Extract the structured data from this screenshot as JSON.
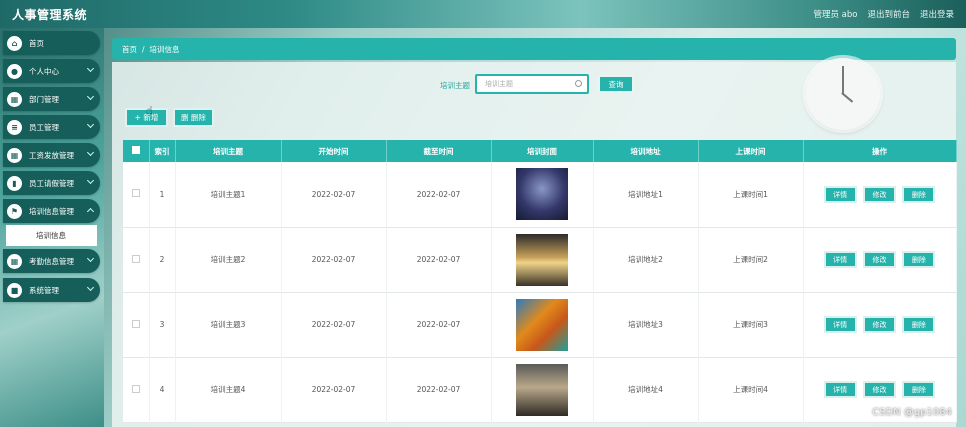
{
  "header": {
    "app_title": "人事管理系统",
    "user_label": "管理员 abo",
    "front_link": "退出到前台",
    "logout_link": "退出登录"
  },
  "sidebar": {
    "items": [
      {
        "label": "首页",
        "icon": "home-icon",
        "has_children": false
      },
      {
        "label": "个人中心",
        "icon": "user-icon",
        "has_children": true
      },
      {
        "label": "部门管理",
        "icon": "grid-icon",
        "has_children": true
      },
      {
        "label": "员工管理",
        "icon": "list-icon",
        "has_children": true
      },
      {
        "label": "工资发放管理",
        "icon": "grid-icon",
        "has_children": true
      },
      {
        "label": "员工请假管理",
        "icon": "bar-chart-icon",
        "has_children": true
      },
      {
        "label": "培训信息管理",
        "icon": "flag-icon",
        "has_children": true
      },
      {
        "label": "考勤信息管理",
        "icon": "grid-icon",
        "has_children": true
      },
      {
        "label": "系统管理",
        "icon": "square-icon",
        "has_children": true
      }
    ],
    "submenu_label": "培训信息"
  },
  "breadcrumb": {
    "home": "首页",
    "separator": "/",
    "current": "培训信息"
  },
  "search": {
    "label": "培训主题",
    "placeholder": "培训主题",
    "button": "查询"
  },
  "actions": {
    "add": "+ 新增",
    "delete": "删 删除"
  },
  "table": {
    "columns": [
      "",
      "索引",
      "培训主题",
      "开始时间",
      "截至时间",
      "培训封面",
      "培训地址",
      "上课时间",
      "操作"
    ],
    "rows": [
      {
        "index": "1",
        "topic": "培训主题1",
        "start": "2022-02-07",
        "end": "2022-02-07",
        "cover": "cover-image-night-sky",
        "address": "培训地址1",
        "class_time": "上课时间1"
      },
      {
        "index": "2",
        "topic": "培训主题2",
        "start": "2022-02-07",
        "end": "2022-02-07",
        "cover": "cover-image-sunset-beach",
        "address": "培训地址2",
        "class_time": "上课时间2"
      },
      {
        "index": "3",
        "topic": "培训主题3",
        "start": "2022-02-07",
        "end": "2022-02-07",
        "cover": "cover-image-autumn-lake",
        "address": "培训地址3",
        "class_time": "上课时间3"
      },
      {
        "index": "4",
        "topic": "培训主题4",
        "start": "2022-02-07",
        "end": "2022-02-07",
        "cover": "cover-image-tree-lake",
        "address": "培训地址4",
        "class_time": "上课时间4"
      }
    ],
    "row_buttons": {
      "detail": "详情",
      "edit": "修改",
      "delete": "删除"
    }
  },
  "watermark": "CSDN @gp1084",
  "colors": {
    "accent": "#26b3ac",
    "sidebar_item": "#155e5a"
  }
}
